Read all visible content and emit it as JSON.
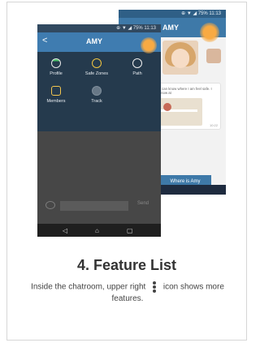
{
  "back_phone": {
    "status": "⊕ ▼ ◢ 75% 11:13",
    "title": "AMY",
    "message": "you can know where I am feel safe. I am now at",
    "time": "10:22",
    "where_label": "Where is",
    "where_name": "Amy"
  },
  "front_phone": {
    "status": "⊕ ▼ ◢ 75% 11:13",
    "back": "<",
    "title": "AMY",
    "features": [
      {
        "label": "Profile"
      },
      {
        "label": "Safe Zones"
      },
      {
        "label": "Path"
      },
      {
        "label": "Members"
      },
      {
        "label": "Track"
      }
    ],
    "send": "Send"
  },
  "caption": {
    "title": "4.  Feature List",
    "text_before": "Inside the chatroom, upper right",
    "text_after": "icon shows more features."
  }
}
